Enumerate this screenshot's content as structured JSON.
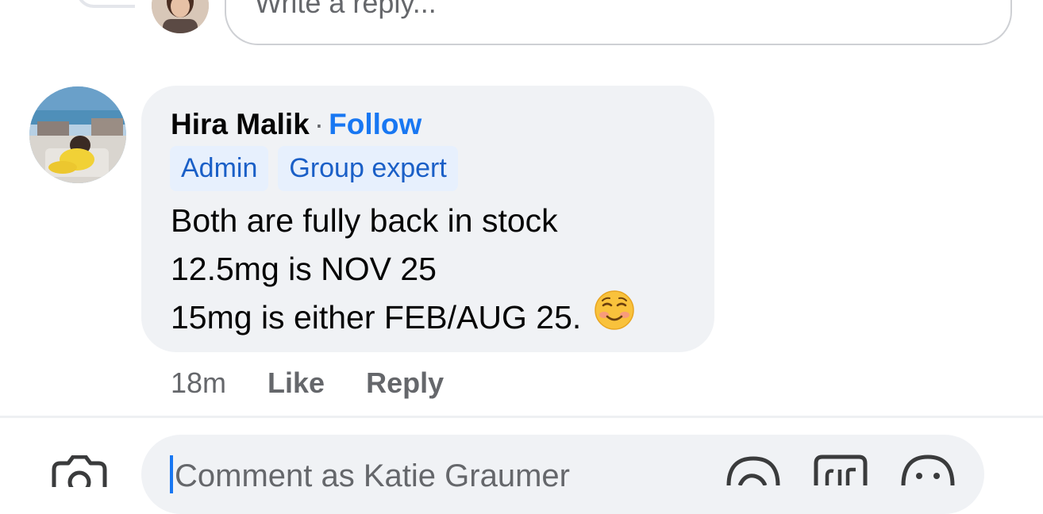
{
  "reply_input": {
    "placeholder": "Write a reply..."
  },
  "comment": {
    "author": "Hira Malik",
    "separator": "·",
    "follow_label": "Follow",
    "badges": [
      "Admin",
      "Group expert"
    ],
    "lines": [
      "Both are fully back in stock",
      "12.5mg is NOV 25",
      "15mg is either FEB/AUG 25."
    ],
    "emoji": "smiling-face-icon",
    "time": "18m",
    "like_label": "Like",
    "reply_label": "Reply"
  },
  "composer": {
    "placeholder": "Comment as Katie Graumer",
    "icons": [
      "camera-icon",
      "sticker-icon",
      "gif-icon",
      "emoji-icon"
    ]
  },
  "colors": {
    "accent": "#1877f2",
    "bubble": "#f0f2f5",
    "badge_bg": "#e7f0fd",
    "badge_text": "#1a5fc7",
    "secondary_text": "#65676b"
  }
}
